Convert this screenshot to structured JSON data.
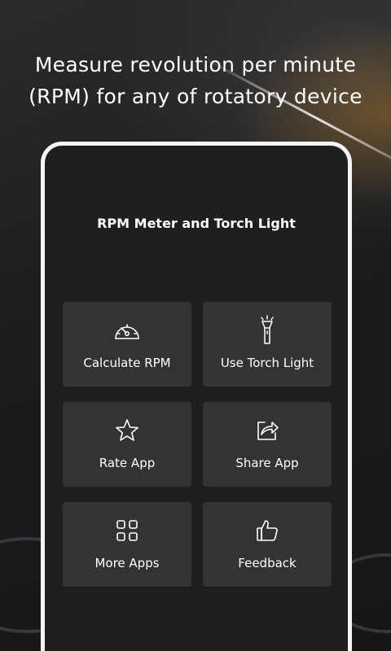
{
  "promo": {
    "headline_line1": "Measure revolution per minute",
    "headline_line2": "(RPM) for any of rotatory device"
  },
  "app": {
    "title": "RPM Meter and Torch Light"
  },
  "menu": {
    "items": [
      {
        "label": "Calculate RPM",
        "icon": "speedometer-icon"
      },
      {
        "label": "Use Torch Light",
        "icon": "flashlight-icon"
      },
      {
        "label": "Rate App",
        "icon": "star-icon"
      },
      {
        "label": "Share App",
        "icon": "share-icon"
      },
      {
        "label": "More Apps",
        "icon": "grid-icon"
      },
      {
        "label": "Feedback",
        "icon": "thumbs-up-icon"
      }
    ]
  },
  "colors": {
    "tile_background": "#333333",
    "screen_background": "#1f1f1f",
    "text": "#ffffff"
  }
}
